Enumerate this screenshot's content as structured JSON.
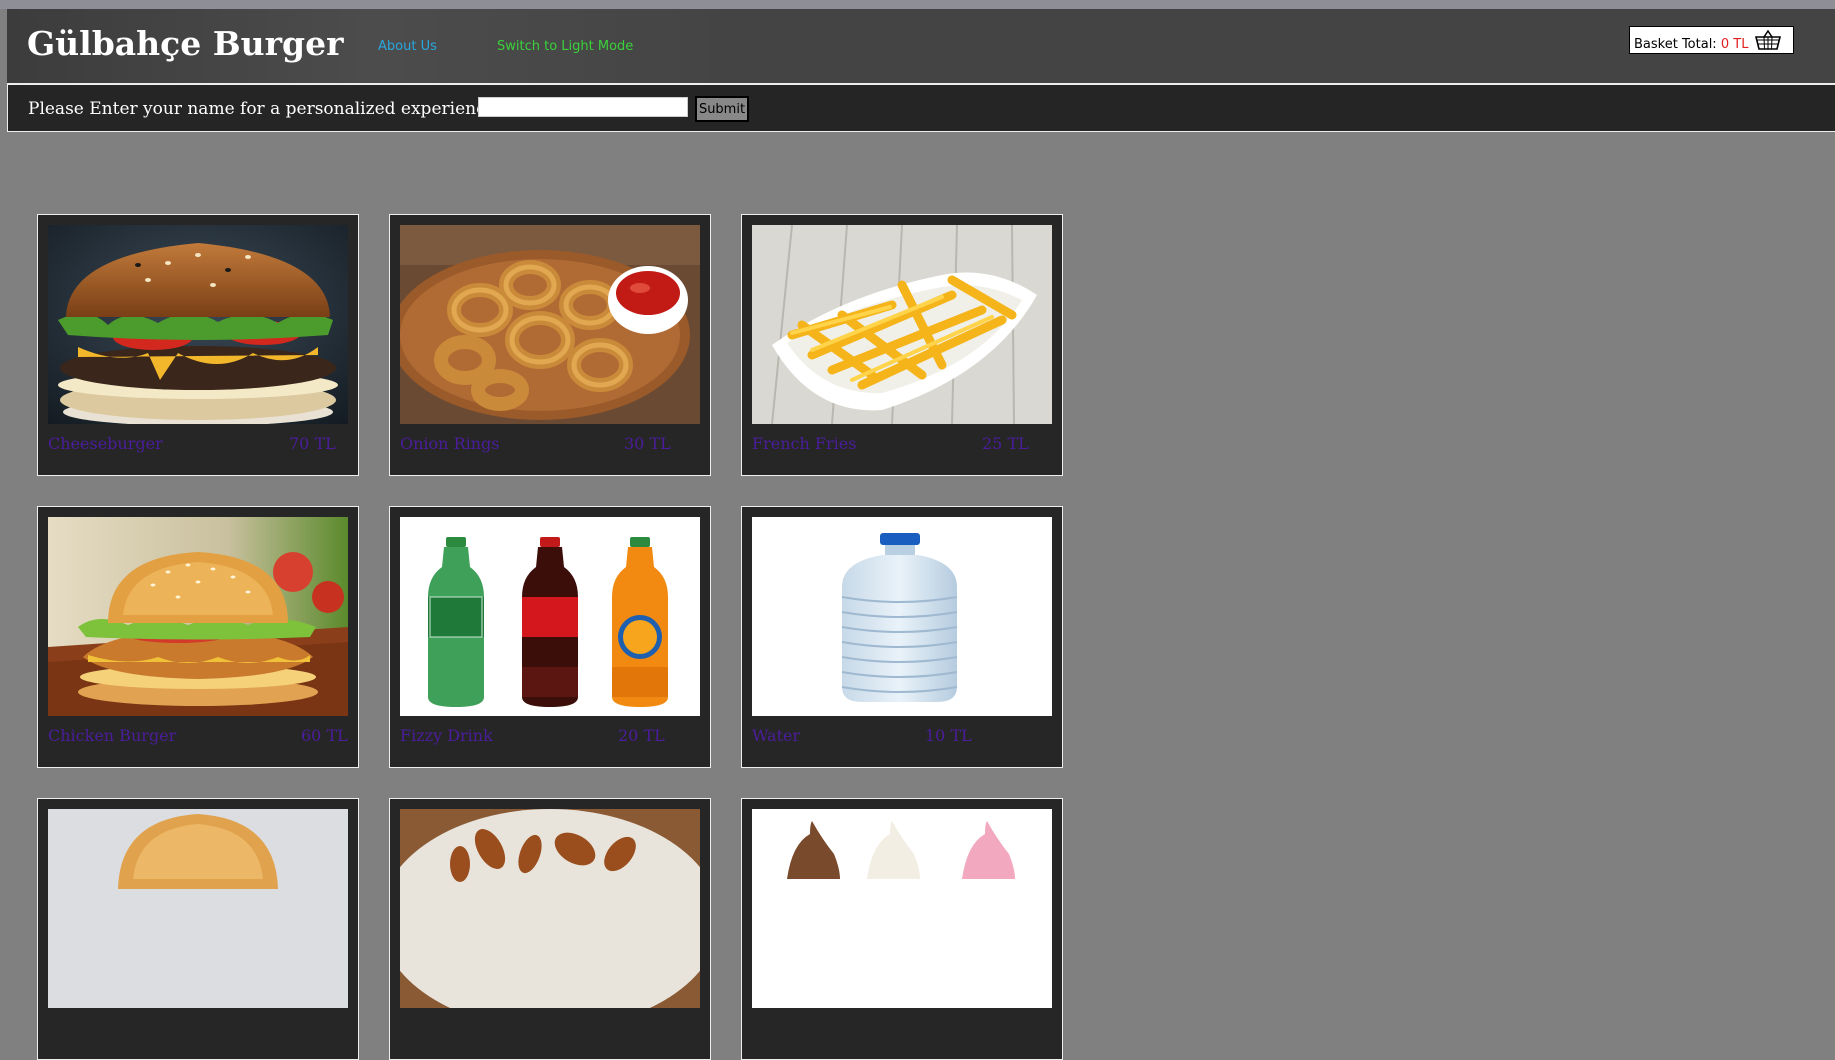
{
  "header": {
    "brand": "Gülbahçe Burger",
    "about": "About Us",
    "mode_toggle": "Switch to Light Mode",
    "basket_label": "Basket Total:",
    "basket_total": "0 TL"
  },
  "namebar": {
    "prompt": "Please Enter your name for a personalized experience:",
    "input_value": "",
    "submit": "Submit"
  },
  "products": [
    {
      "name": "Cheeseburger",
      "price": "70 TL"
    },
    {
      "name": "Onion Rings",
      "price": "30 TL"
    },
    {
      "name": "French Fries",
      "price": "25 TL"
    },
    {
      "name": "Chicken Burger",
      "price": "60 TL"
    },
    {
      "name": "Fizzy Drink",
      "price": "20 TL"
    },
    {
      "name": "Water",
      "price": "10 TL"
    }
  ],
  "colors": {
    "background": "#808080",
    "about_link": "#29a8e0",
    "mode_link": "#3ad13a",
    "basket_total": "#e02020",
    "product_text": "#4b1d9b"
  }
}
